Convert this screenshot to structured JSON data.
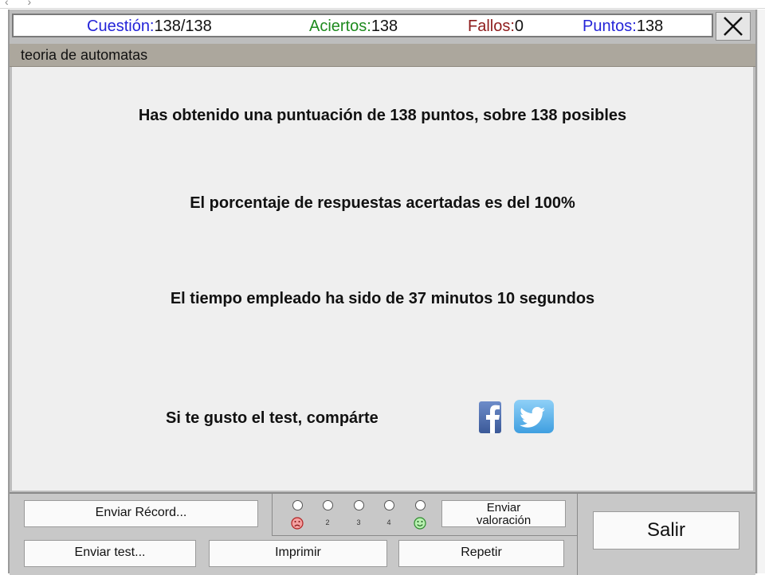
{
  "stats": {
    "question_label": "Cuestión:",
    "question_value": "138/138",
    "hits_label": "Aciertos:",
    "hits_value": "138",
    "misses_label": "Fallos:",
    "misses_value": "0",
    "points_label": "Puntos:",
    "points_value": "138"
  },
  "topic": "teoria de automatas",
  "results": {
    "score_text": "Has obtenido una puntuación de 138 puntos, sobre 138 posibles",
    "percent_text": "El porcentaje de respuestas acertadas es del 100%",
    "time_text": "El tiempo empleado ha sido de 37 minutos 10 segundos",
    "share_text": "Si te gusto el test, compárte"
  },
  "rating": {
    "labels": [
      "2",
      "3",
      "4"
    ]
  },
  "buttons": {
    "send_record": "Enviar Récord...",
    "send_test": "Enviar test...",
    "print": "Imprimir",
    "repeat": "Repetir",
    "send_rating_line1": "Enviar",
    "send_rating_line2": "valoración",
    "exit": "Salir"
  },
  "colors": {
    "question": "#2424d8",
    "hits": "#1e8a1e",
    "misses": "#8e1b1b",
    "points": "#2424d8",
    "facebook": "#3b5998",
    "twitter": "#55acee"
  },
  "icons": [
    "back-arrow-icon",
    "close-icon",
    "facebook-icon",
    "twitter-icon",
    "sad-face-icon",
    "happy-face-icon"
  ]
}
